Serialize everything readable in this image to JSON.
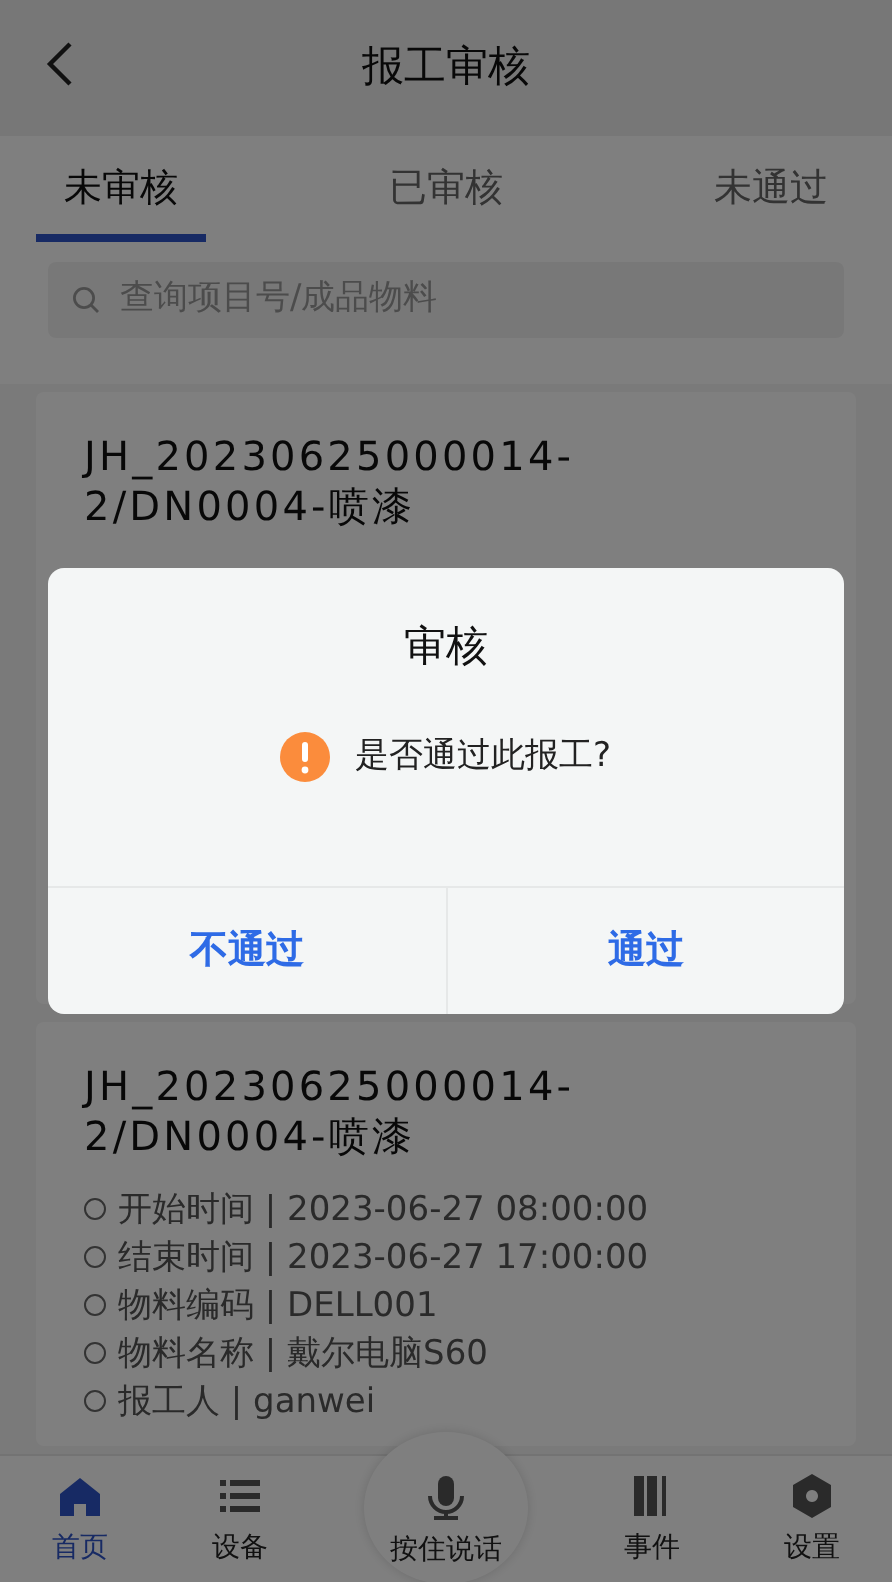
{
  "header": {
    "title": "报工审核"
  },
  "tabs": [
    {
      "label": "未审核",
      "selected": true
    },
    {
      "label": "已审核",
      "selected": false
    },
    {
      "label": "未通过",
      "selected": false
    }
  ],
  "search": {
    "placeholder": "查询项目号/成品物料"
  },
  "cards": [
    {
      "title": "JH_20230625000014-2/DN0004-喷漆"
    },
    {
      "title": "JH_20230625000014-2/DN0004-喷漆",
      "details": [
        "开始时间 | 2023-06-27 08:00:00",
        "结束时间 | 2023-06-27 17:00:00",
        "物料编码 | DELL001",
        "物料名称 | 戴尔电脑S60",
        "报工人 | ganwei"
      ]
    }
  ],
  "dialog": {
    "title": "审核",
    "message": "是否通过此报工?",
    "buttons": [
      {
        "label": "不通过"
      },
      {
        "label": "通过"
      }
    ]
  },
  "tabbar": [
    {
      "label": "首页",
      "kind": "tab",
      "selected": true
    },
    {
      "label": "设备",
      "kind": "tab",
      "selected": false
    },
    {
      "label": "按住说话",
      "kind": "voice",
      "selected": false
    },
    {
      "label": "事件",
      "kind": "tab",
      "selected": false
    },
    {
      "label": "设置",
      "kind": "tab",
      "selected": false
    }
  ]
}
